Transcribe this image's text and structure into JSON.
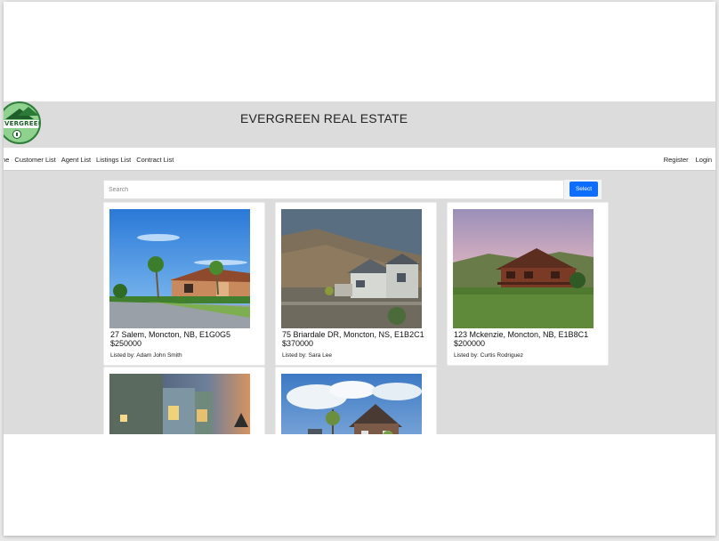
{
  "header": {
    "title": "EVERGREEN REAL ESTATE",
    "logo_text": "EVERGREEN"
  },
  "nav": {
    "left": [
      "me",
      "Customer List",
      "Agent List",
      "Listings List",
      "Contract List"
    ],
    "right": [
      "Register",
      "Login"
    ]
  },
  "search": {
    "placeholder": "Search",
    "button_label": "Select"
  },
  "listings": [
    {
      "address": "27 Salem, Moncton, NB, E1G0G5",
      "price": "$250000",
      "agent_prefix": "Listed by:",
      "agent": "Adam John Smith"
    },
    {
      "address": "75 Briardale DR, Moncton, NS, E1B2C1",
      "price": "$370000",
      "agent_prefix": "Listed by:",
      "agent": "Sara Lee"
    },
    {
      "address": "123 Mckenzie, Moncton, NB, E1B8C1",
      "price": "$200000",
      "agent_prefix": "Listed by:",
      "agent": "Curtis Rodriguez"
    },
    {
      "address": "",
      "price": "",
      "agent_prefix": "",
      "agent": ""
    },
    {
      "address": "",
      "price": "",
      "agent_prefix": "",
      "agent": ""
    }
  ],
  "colors": {
    "page_bg": "#dcdcdc",
    "accent": "#0d6efd",
    "logo_green": "#2f7d3a"
  }
}
